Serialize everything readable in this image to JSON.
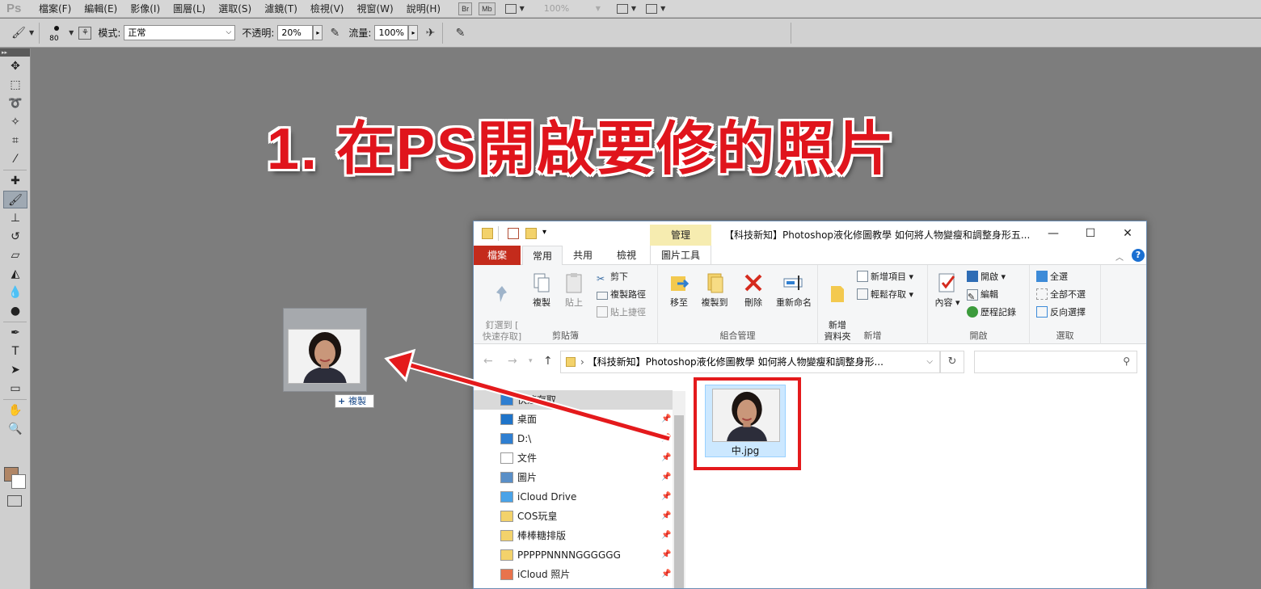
{
  "photoshop": {
    "logo": "Ps",
    "menus": [
      "檔案(F)",
      "編輯(E)",
      "影像(I)",
      "圖層(L)",
      "選取(S)",
      "濾鏡(T)",
      "檢視(V)",
      "視窗(W)",
      "說明(H)"
    ],
    "bridge_btn": "Br",
    "minibridge_btn": "Mb",
    "zoom": "100%",
    "options": {
      "brush_size": "80",
      "mode_label": "模式:",
      "mode_value": "正常",
      "opacity_label": "不透明:",
      "opacity_value": "20%",
      "flow_label": "流量:",
      "flow_value": "100%"
    },
    "foreground_color": "#b08666",
    "background_color": "#ffffff"
  },
  "overlay": {
    "title": "1. 在PS開啟要修的照片",
    "drag_copy_label": "複製",
    "title_color": "#e0141c"
  },
  "explorer": {
    "title": "【科技新知】Photoshop液化修圖教學 如何將人物變瘦和調整身形五...",
    "manage_tab": "管理",
    "tabs": {
      "file": "檔案",
      "home": "常用",
      "share": "共用",
      "view": "檢視",
      "picture_tools": "圖片工具"
    },
    "ribbon": {
      "clipboard": {
        "pin": "釘選到 [\n快速存取]",
        "copy": "複製",
        "paste": "貼上",
        "cut": "剪下",
        "copy_path": "複製路徑",
        "paste_shortcut": "貼上捷徑",
        "label": "剪貼簿"
      },
      "organize": {
        "move_to": "移至",
        "copy_to": "複製到",
        "delete": "刪除",
        "rename": "重新命名",
        "label": "組合管理"
      },
      "new": {
        "new_folder": "新增\n資料夾",
        "new_item": "新增項目",
        "easy_access": "輕鬆存取",
        "label": "新增"
      },
      "open": {
        "properties": "內容",
        "open": "開啟",
        "edit": "編輯",
        "history": "歷程記錄",
        "label": "開啟"
      },
      "select": {
        "select_all": "全選",
        "select_none": "全部不選",
        "invert": "反向選擇",
        "label": "選取"
      }
    },
    "address": "【科技新知】Photoshop液化修圖教學 如何將人物變瘦和調整身形...",
    "nav_items": [
      {
        "label": "快速存取",
        "icon": "star-icon"
      },
      {
        "label": "桌面",
        "icon": "desktop-icon"
      },
      {
        "label": "D:\\",
        "icon": "download-icon"
      },
      {
        "label": "文件",
        "icon": "document-icon"
      },
      {
        "label": "圖片",
        "icon": "pictures-icon"
      },
      {
        "label": "iCloud Drive",
        "icon": "icloud-icon"
      },
      {
        "label": "COS玩皇",
        "icon": "folder-icon"
      },
      {
        "label": "棒棒糖排版",
        "icon": "folder-icon"
      },
      {
        "label": "PPPPPNNNNGGGGGG",
        "icon": "folder-icon"
      },
      {
        "label": "iCloud 照片",
        "icon": "photos-icon"
      }
    ],
    "file": {
      "name": "中.jpg"
    }
  }
}
